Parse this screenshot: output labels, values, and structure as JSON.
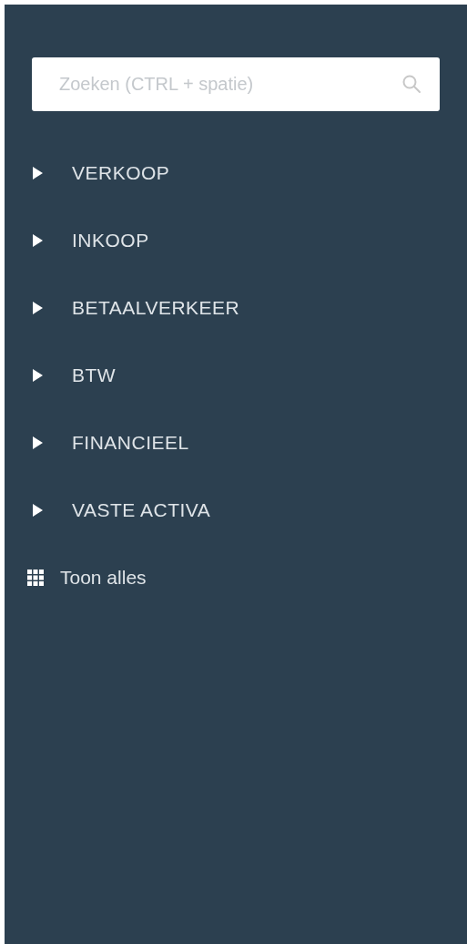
{
  "search": {
    "placeholder": "Zoeken (CTRL + spatie)"
  },
  "menu": [
    {
      "label": "VERKOOP",
      "expanded": false
    },
    {
      "label": "INKOOP",
      "expanded": false
    },
    {
      "label": "BETAALVERKEER",
      "expanded": false
    },
    {
      "label": "BTW",
      "expanded": false
    },
    {
      "label": "FINANCIEEL",
      "expanded": false
    },
    {
      "label": "VASTE ACTIVA",
      "expanded": false
    }
  ],
  "show_all": {
    "label": "Toon alles"
  }
}
